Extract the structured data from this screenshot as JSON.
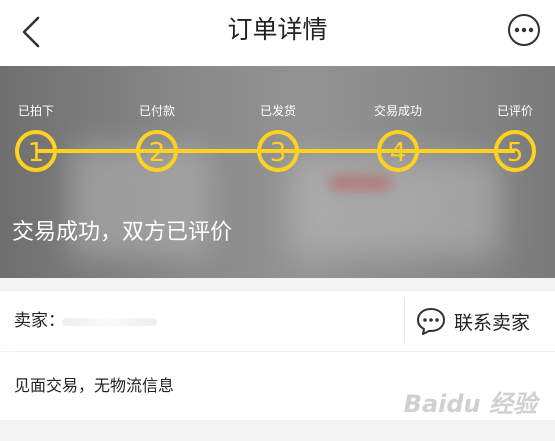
{
  "header": {
    "title": "订单详情",
    "back_icon": "chevron-left-icon",
    "more_icon": "ellipsis-circle-icon"
  },
  "progress": {
    "steps": [
      {
        "label": "已拍下",
        "number": "1"
      },
      {
        "label": "已付款",
        "number": "2"
      },
      {
        "label": "已发货",
        "number": "3"
      },
      {
        "label": "交易成功",
        "number": "4"
      },
      {
        "label": "已评价",
        "number": "5"
      }
    ],
    "completed": 5,
    "accent_color": "#ffd21f"
  },
  "status_text": "交易成功，双方已评价",
  "seller": {
    "label": "卖家：",
    "contact_label": "联系卖家",
    "contact_icon": "chat-bubble-icon"
  },
  "delivery_info": "见面交易，无物流信息",
  "watermark": "Baidu 经验"
}
